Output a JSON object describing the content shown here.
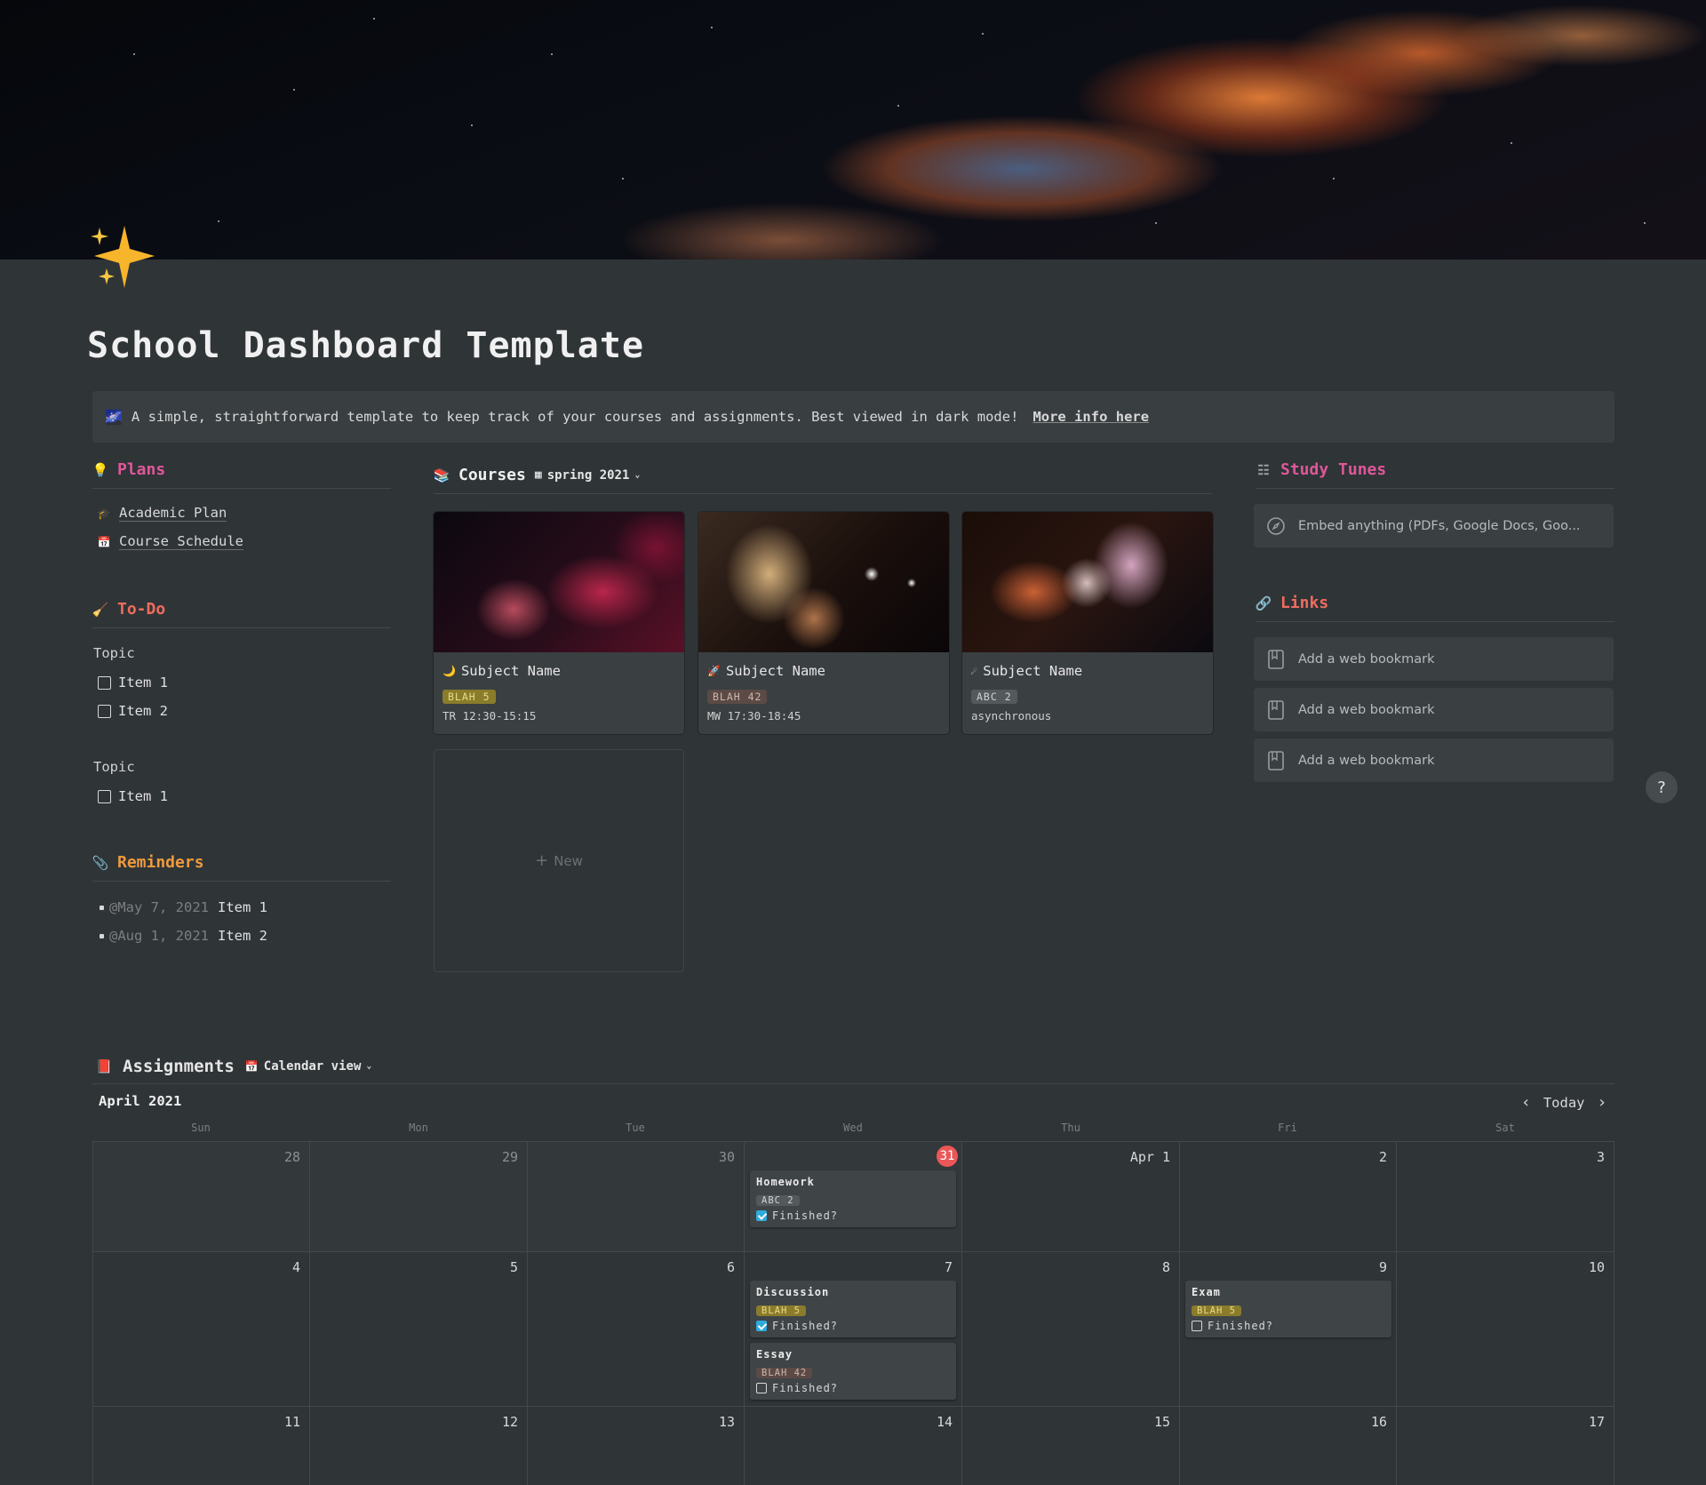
{
  "page": {
    "title": "School Dashboard Template",
    "callout_text": "A simple, straightforward template to keep track of your courses and assignments. Best viewed in dark mode!",
    "callout_link": "More info here",
    "callout_icon": "galaxy-icon",
    "page_icon": "sparkles-icon"
  },
  "plans": {
    "heading": "Plans",
    "icon": "lightbulb-icon",
    "items": [
      {
        "label": "Academic Plan",
        "icon": "graduation-cap-icon"
      },
      {
        "label": "Course Schedule",
        "icon": "calendar-icon"
      }
    ]
  },
  "todo": {
    "heading": "To-Do",
    "icon": "broom-icon",
    "groups": [
      {
        "topic": "Topic",
        "items": [
          "Item 1",
          "Item 2"
        ]
      },
      {
        "topic": "Topic",
        "items": [
          "Item 1"
        ]
      }
    ]
  },
  "reminders": {
    "heading": "Reminders",
    "icon": "paperclip-icon",
    "items": [
      {
        "date": "@May 7, 2021",
        "text": "Item 1"
      },
      {
        "date": "@Aug 1, 2021",
        "text": "Item 2"
      }
    ]
  },
  "courses": {
    "heading": "Courses",
    "icon": "books-icon",
    "view": "spring 2021",
    "cards": [
      {
        "name": "Subject Name",
        "icon": "moon-icon",
        "tag": "BLAH 5",
        "time": "TR 12:30-15:15"
      },
      {
        "name": "Subject Name",
        "icon": "rocket-icon",
        "tag": "BLAH 42",
        "time": "MW 17:30-18:45"
      },
      {
        "name": "Subject Name",
        "icon": "comet-icon",
        "tag": "ABC 2",
        "time": "asynchronous"
      }
    ],
    "new_label": "New"
  },
  "study_tunes": {
    "heading": "Study Tunes",
    "icon": "music-list-icon",
    "embed_text": "Embed anything (PDFs, Google Docs, Goo..."
  },
  "links": {
    "heading": "Links",
    "icon": "link-icon",
    "bookmarks": [
      "Add a web bookmark",
      "Add a web bookmark",
      "Add a web bookmark"
    ]
  },
  "help": {
    "label": "?"
  },
  "assignments": {
    "heading": "Assignments",
    "icon": "notebook-icon",
    "view": "Calendar view",
    "month": "April 2021",
    "today_label": "Today",
    "weekdays": [
      "Sun",
      "Mon",
      "Tue",
      "Wed",
      "Thu",
      "Fri",
      "Sat"
    ],
    "weeks": [
      [
        "28",
        "29",
        "30",
        "31",
        "Apr 1",
        "2",
        "3"
      ],
      [
        "4",
        "5",
        "6",
        "7",
        "8",
        "9",
        "10"
      ],
      [
        "11",
        "12",
        "13",
        "14",
        "15",
        "16",
        "17"
      ]
    ],
    "events": [
      {
        "title": "Homework",
        "tag": "ABC 2",
        "finished_label": "Finished?",
        "finished": true
      },
      {
        "title": "Discussion",
        "tag": "BLAH 5",
        "finished_label": "Finished?",
        "finished": true
      },
      {
        "title": "Essay",
        "tag": "BLAH 42",
        "finished_label": "Finished?",
        "finished": false
      },
      {
        "title": "Exam",
        "tag": "BLAH 5",
        "finished_label": "Finished?",
        "finished": false
      }
    ]
  },
  "colors": {
    "background": "#2f3437",
    "pink": "#e0579a",
    "red": "#ef6c5d",
    "orange": "#ee9a3d",
    "today": "#eb5757",
    "check": "#2eaadc"
  }
}
